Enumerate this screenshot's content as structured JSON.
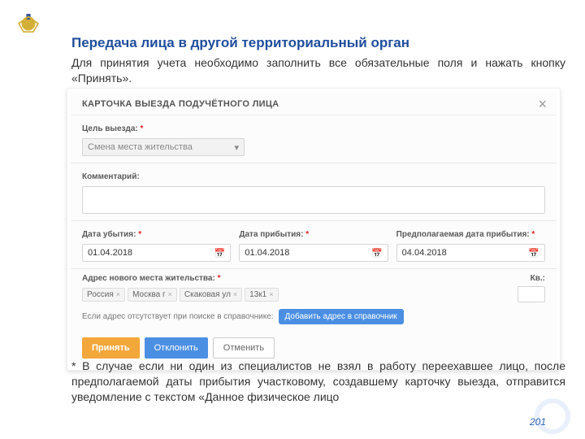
{
  "page": {
    "title": "Передача лица в другой территориальный орган",
    "intro": "Для принятия учета необходимо заполнить все обязательные поля и нажать кнопку «Принять».",
    "footnote": "* В случае если ни один из специалистов не взял в работу переехавшее лицо, после предполагаемой даты прибытия участковому, создавшему карточку выезда, отправится уведомление с текстом «Данное физическое лицо",
    "pagenum": "201"
  },
  "card": {
    "title": "КАРТОЧКА ВЫЕЗДА ПОДУЧЁТНОГО ЛИЦА",
    "purpose_label": "Цель выезда:",
    "purpose_value": "Смена места жительства",
    "comment_label": "Комментарий:",
    "date_depart_label": "Дата убытия:",
    "date_depart_value": "01.04.2018",
    "date_arrive_label": "Дата прибытия:",
    "date_arrive_value": "01.04.2018",
    "date_expected_label": "Предполагаемая дата прибытия:",
    "date_expected_value": "04.04.2018",
    "address_label": "Адрес нового места жительства:",
    "kv_label": "Кв.:",
    "chips": [
      "Россия",
      "Москва г",
      "Скаковая ул",
      "13к1"
    ],
    "help_text": "Если адрес отсутствует при поиске в справочнике:",
    "add_address_btn": "Добавить адрес в справочник",
    "accept_btn": "Принять",
    "decline_btn": "Отклонить",
    "cancel_btn": "Отменить"
  }
}
